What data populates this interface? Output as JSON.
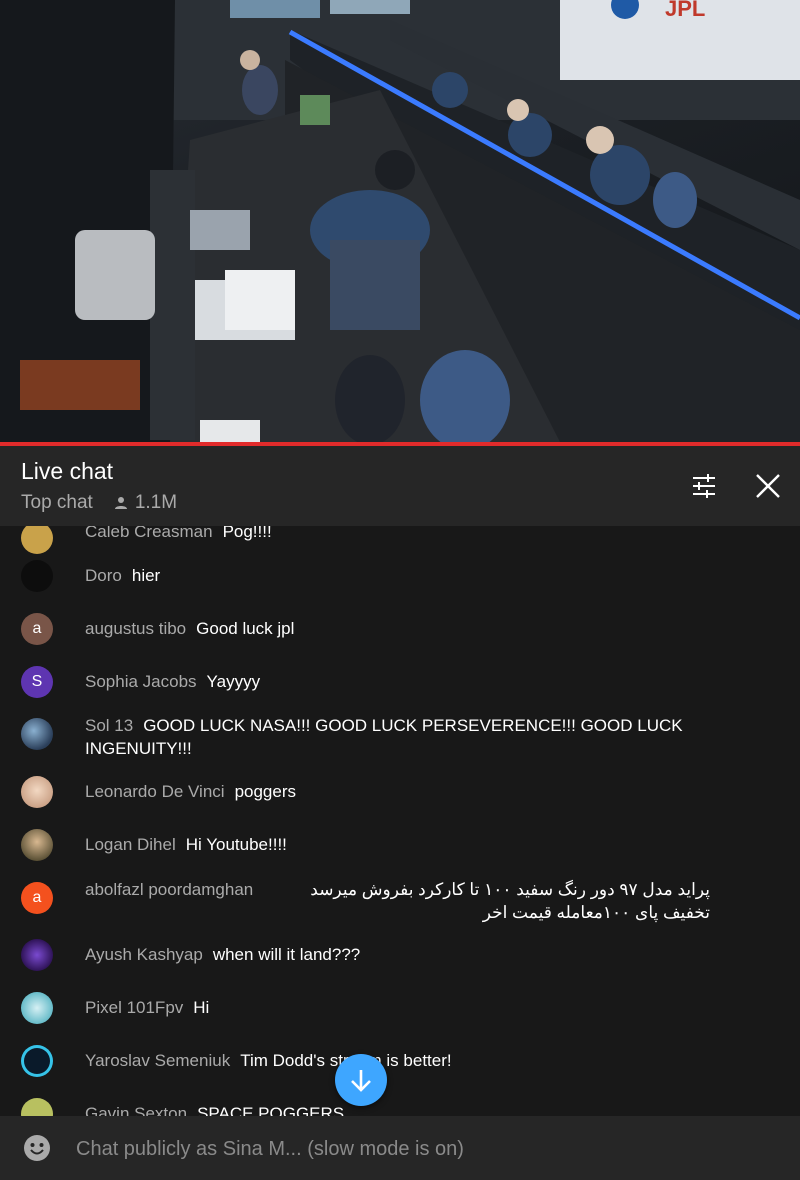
{
  "header": {
    "title": "Live chat",
    "mode": "Top chat",
    "viewers": "1.1M"
  },
  "messages": [
    {
      "author": "Caleb Creasman",
      "text": "Pog!!!!",
      "avatar": {
        "type": "image",
        "color": "#c9a24a"
      }
    },
    {
      "author": "Doro",
      "text": "hier",
      "avatar": {
        "type": "image",
        "color": "#0d0d0d"
      }
    },
    {
      "author": "augustus tibo",
      "text": "Good luck jpl",
      "avatar": {
        "type": "letter",
        "letter": "a",
        "color": "#795548"
      }
    },
    {
      "author": "Sophia Jacobs",
      "text": "Yayyyy",
      "avatar": {
        "type": "letter",
        "letter": "S",
        "color": "#5e35b1"
      }
    },
    {
      "author": "Sol 13",
      "text": "GOOD LUCK NASA!!! GOOD LUCK PERSEVERENCE!!! GOOD LUCK INGENUITY!!!",
      "avatar": {
        "type": "image",
        "color": "#3a5a7a"
      }
    },
    {
      "author": "Leonardo De Vinci",
      "text": "poggers",
      "avatar": {
        "type": "image",
        "color": "#e8c4a8"
      }
    },
    {
      "author": "Logan Dihel",
      "text": "Hi Youtube!!!!",
      "avatar": {
        "type": "image",
        "color": "#8a7a55"
      }
    },
    {
      "author": "abolfazl poordamghan",
      "text": "پراید مدل ۹۷ دور رنگ سفید ۱۰۰ تا کارکرد بفروش میرسد تخفیف پای ۱۰۰معامله قیمت اخر",
      "avatar": {
        "type": "letter",
        "letter": "a",
        "color": "#f4511e"
      }
    },
    {
      "author": "Ayush Kashyap",
      "text": "when will it land???",
      "avatar": {
        "type": "image",
        "color": "#4a2a8a"
      }
    },
    {
      "author": "Pixel 101Fpv",
      "text": "Hi",
      "avatar": {
        "type": "image",
        "color": "#9ad8e0"
      }
    },
    {
      "author": "Yaroslav Semeniuk",
      "text": "Tim Dodd's stream is better!",
      "avatar": {
        "type": "image",
        "color": "#0a1a2a"
      }
    },
    {
      "author": "Gavin Sexton",
      "text": "SPACE POGGERS",
      "avatar": {
        "type": "image",
        "color": "#b8c060"
      }
    }
  ],
  "input": {
    "placeholder": "Chat publicly as Sina M... (slow mode is on)"
  },
  "colors": {
    "accent_red": "#e12b2b",
    "scroll_button": "#3ea6ff",
    "header_bg": "#262626",
    "chat_bg": "#181818"
  },
  "icons": [
    "person-icon",
    "settings-sliders-icon",
    "close-icon",
    "arrow-down-icon",
    "emoji-icon"
  ]
}
